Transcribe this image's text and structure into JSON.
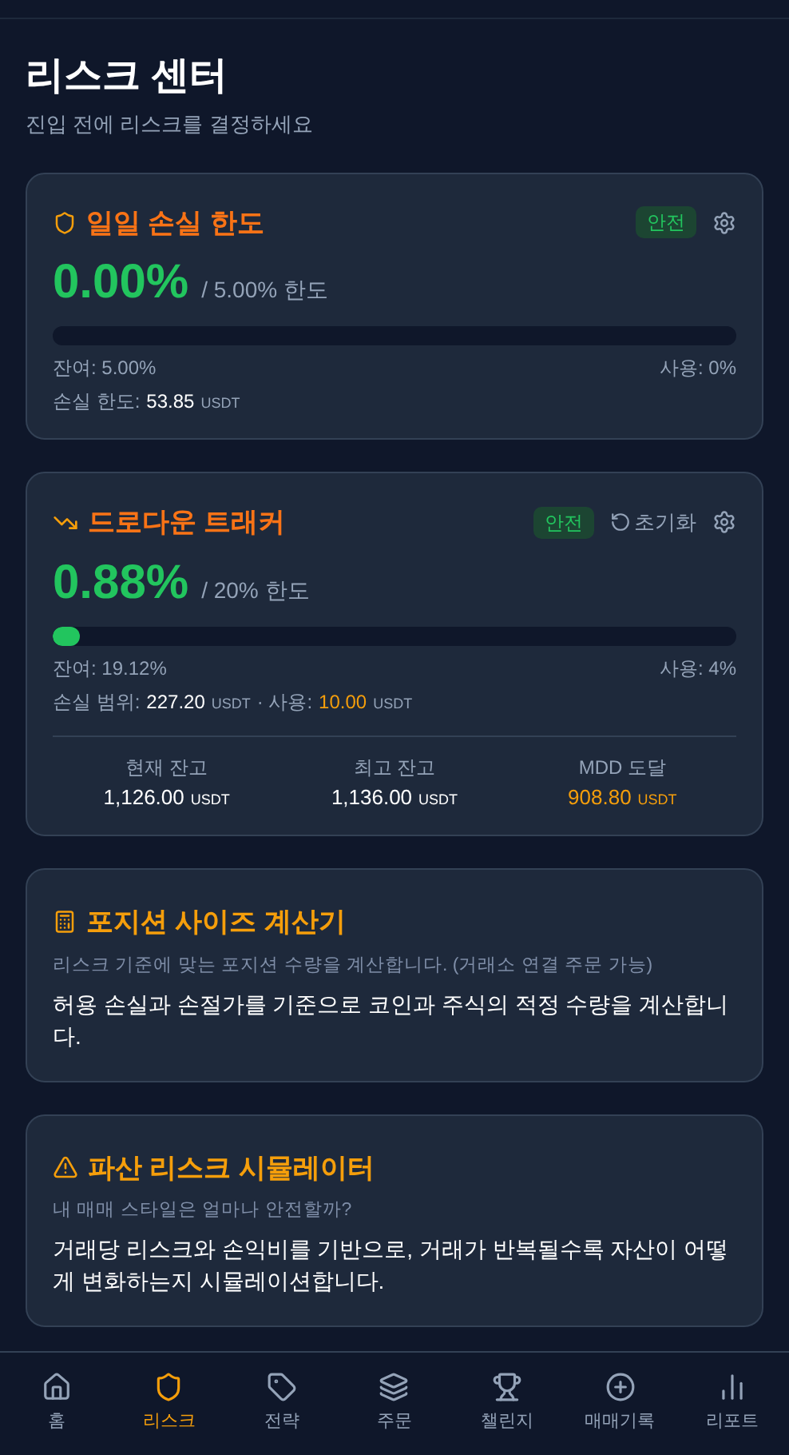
{
  "header": {
    "title": "리스크 센터",
    "subtitle": "진입 전에 리스크를 결정하세요"
  },
  "daily_limit": {
    "title": "일일 손실 한도",
    "status": "안전",
    "value": "0.00%",
    "limit": "/ 5.00% 한도",
    "level": 0,
    "remaining": "잔여: 5.00%",
    "usage": "사용: 0%",
    "detail": [
      {
        "kind": "label",
        "text": "손실 한도:"
      },
      {
        "kind": "value",
        "text": "53.85"
      },
      {
        "kind": "unit",
        "text": "USDT"
      }
    ]
  },
  "drawdown": {
    "title": "드로다운 트래커",
    "status": "안전",
    "reset": "초기화",
    "value": "0.88%",
    "limit": "/ 20% 한도",
    "level": 0.04,
    "remaining": "잔여: 19.12%",
    "usage": "사용: 4%",
    "detail": [
      {
        "kind": "label",
        "text": "손실 범위:"
      },
      {
        "kind": "value",
        "text": "227.20"
      },
      {
        "kind": "unit",
        "text": "USDT"
      },
      {
        "kind": "label",
        "text": "· 사용:"
      },
      {
        "kind": "warn",
        "text": "10.00"
      },
      {
        "kind": "unit",
        "text": "USDT"
      }
    ],
    "stats": [
      {
        "label": "현재 잔고",
        "value": "1,126.00",
        "unit": "USDT",
        "kind": "normal"
      },
      {
        "label": "최고 잔고",
        "value": "1,136.00",
        "unit": "USDT",
        "kind": "normal"
      },
      {
        "label": "MDD 도달",
        "value": "908.80",
        "unit": "USDT",
        "kind": "warn"
      }
    ]
  },
  "tools": [
    {
      "kind": "calculator",
      "title": "포지션 사이즈 계산기",
      "subtitle": "리스크 기준에 맞는 포지션 수량을 계산합니다. (거래소 연결 주문 가능)",
      "description": "허용 손실과 손절가를 기준으로 코인과 주식의 적정 수량을 계산합니다."
    },
    {
      "kind": "warning",
      "title": "파산 리스크 시뮬레이터",
      "subtitle": "내 매매 스타일은 얼마나 안전할까?",
      "description": "거래당 리스크와 손익비를 기반으로, 거래가 반복될수록 자산이 어떻게 변화하는지 시뮬레이션합니다."
    }
  ],
  "nav": [
    {
      "kind": "home",
      "label": "홈",
      "selected": false
    },
    {
      "kind": "shield",
      "label": "리스크",
      "selected": true
    },
    {
      "kind": "tag",
      "label": "전략",
      "selected": false
    },
    {
      "kind": "layers",
      "label": "주문",
      "selected": false
    },
    {
      "kind": "trophy",
      "label": "챌린지",
      "selected": false
    },
    {
      "kind": "plus",
      "label": "매매기록",
      "selected": false
    },
    {
      "kind": "chart",
      "label": "리포트",
      "selected": false
    }
  ]
}
